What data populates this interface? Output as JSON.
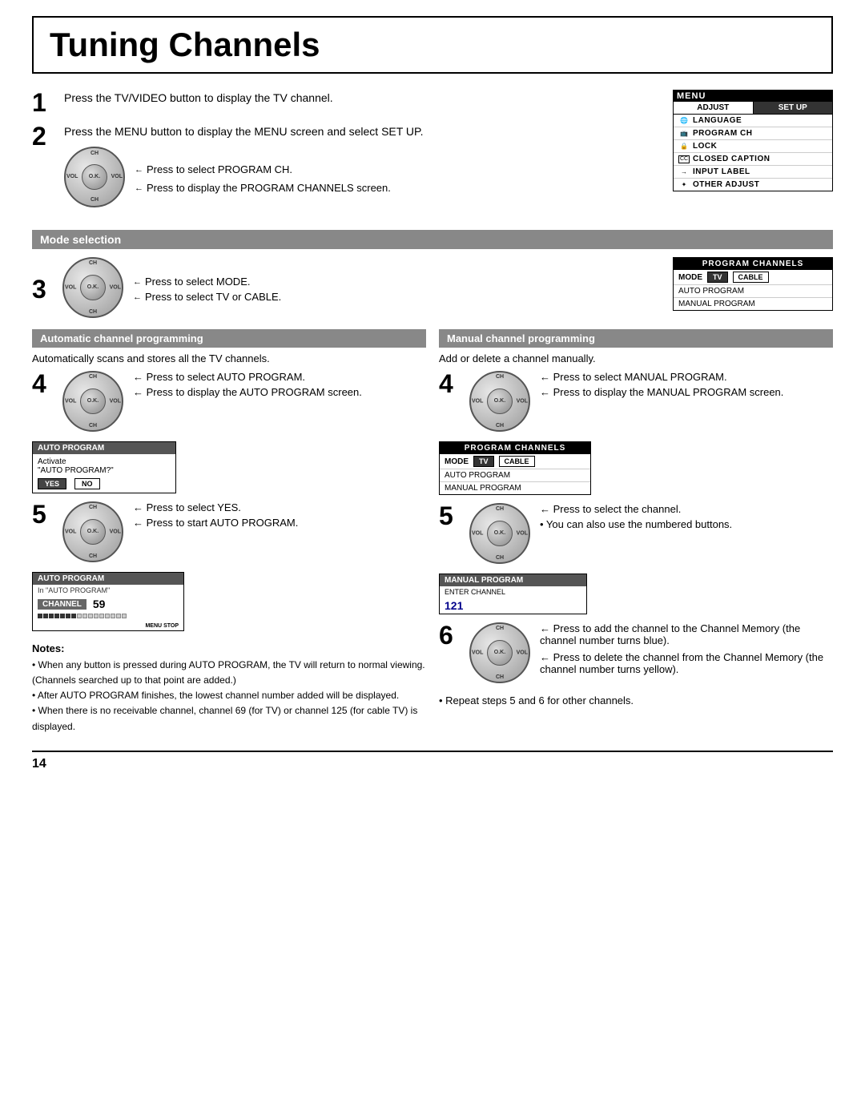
{
  "page": {
    "title": "Tuning Channels",
    "page_number": "14"
  },
  "steps": {
    "step1": {
      "num": "1",
      "text": "Press the TV/VIDEO button to display the TV channel."
    },
    "step2": {
      "num": "2",
      "text": "Press the MENU button to display the MENU screen and select SET UP.",
      "annotation1": "Press to select PROGRAM CH.",
      "annotation2": "Press to display the PROGRAM CHANNELS screen."
    },
    "step3": {
      "num": "3",
      "annotation1": "Press to select MODE.",
      "annotation2": "Press to select TV or CABLE."
    },
    "step4_auto": {
      "num": "4",
      "annotation1": "Press to select AUTO PROGRAM.",
      "annotation2": "Press to display the AUTO PROGRAM screen."
    },
    "step4_manual": {
      "num": "4",
      "annotation1": "Press to select MANUAL PROGRAM.",
      "annotation2": "Press to display the MANUAL PROGRAM screen."
    },
    "step5_auto": {
      "num": "5",
      "annotation1": "Press to select YES.",
      "annotation2": "Press to start AUTO PROGRAM."
    },
    "step5_manual": {
      "num": "5",
      "annotation1": "Press to select the channel.",
      "annotation2": "• You can also use the numbered buttons."
    },
    "step6_manual": {
      "num": "6",
      "annotation1": "Press to add the channel to the Channel Memory (the channel number turns blue).",
      "annotation2": "Press to delete the channel from the Channel Memory (the channel number turns yellow)."
    }
  },
  "menu": {
    "title": "MENU",
    "tab1": "ADJUST",
    "tab2": "SET UP",
    "items": [
      {
        "icon": "🌐",
        "label": "LANGUAGE"
      },
      {
        "icon": "📺",
        "label": "PROGRAM CH"
      },
      {
        "icon": "🔒",
        "label": "LOCK"
      },
      {
        "icon": "CC",
        "label": "CLOSED CAPTION"
      },
      {
        "icon": "→",
        "label": "INPUT LABEL"
      },
      {
        "icon": "★",
        "label": "OTHER ADJUST"
      }
    ]
  },
  "mode_selection": {
    "heading": "Mode selection"
  },
  "program_channels_box": {
    "title": "PROGRAM CHANNELS",
    "mode_label": "MODE",
    "tv_label": "TV",
    "cable_label": "CABLE",
    "auto_label": "AUTO PROGRAM",
    "manual_label": "MANUAL PROGRAM"
  },
  "auto_section": {
    "heading": "Automatic channel programming",
    "sub": "Automatically scans and stores all the TV channels.",
    "screen1_title": "AUTO PROGRAM",
    "screen1_activate": "Activate",
    "screen1_question": "\"AUTO PROGRAM?\"",
    "screen1_yes": "YES",
    "screen1_no": "NO",
    "screen2_title": "AUTO PROGRAM",
    "screen2_sub": "In \"AUTO PROGRAM\"",
    "screen2_channel_label": "CHANNEL",
    "screen2_channel_num": "59",
    "stop_label": "STOP"
  },
  "manual_section": {
    "heading": "Manual channel programming",
    "sub": "Add or delete a channel manually.",
    "screen1_title": "PROGRAM CHANNELS",
    "screen1_mode": "MODE",
    "screen1_tv": "TV",
    "screen1_cable": "CABLE",
    "screen1_auto": "AUTO PROGRAM",
    "screen1_manual": "MANUAL PROGRAM",
    "screen2_title": "MANUAL PROGRAM",
    "screen2_enter": "ENTER CHANNEL",
    "screen2_num": "121"
  },
  "notes": {
    "title": "Notes:",
    "items": [
      "• When any button is pressed during AUTO PROGRAM, the TV will return to normal viewing. (Channels searched up to that point are added.)",
      "• After AUTO PROGRAM finishes, the lowest channel number added will be displayed.",
      "• When there is no receivable channel, channel 69 (for TV) or channel 125 (for cable TV) is displayed."
    ],
    "manual_note": "• Repeat steps 5 and 6 for other channels."
  },
  "dial": {
    "ok": "O.K.",
    "vol": "VOL",
    "ch": "CH"
  }
}
